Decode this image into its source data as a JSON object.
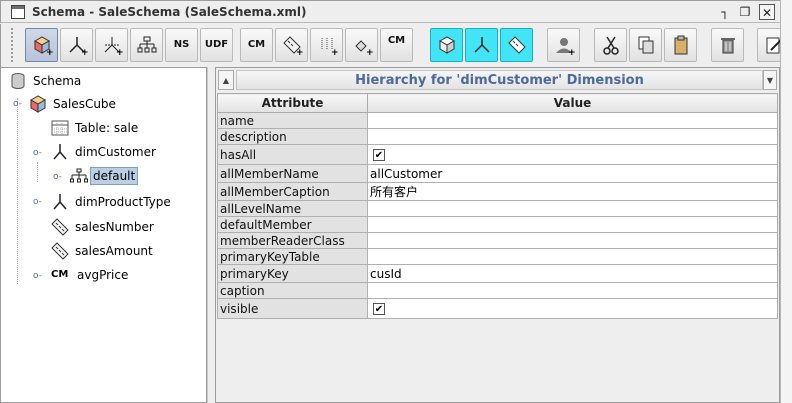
{
  "window": {
    "title": "Schema - SaleSchema (SaleSchema.xml)",
    "controls": {
      "iconify": "┐",
      "maximize": "❐",
      "close": "✕"
    }
  },
  "toolbar": {
    "buttons": [
      {
        "name": "add-cube",
        "label": "",
        "icon": "cube-add-icon",
        "state": "pressed"
      },
      {
        "name": "add-dimension",
        "label": "",
        "icon": "dimension-add-icon"
      },
      {
        "name": "add-dimension-usage",
        "label": "",
        "icon": "dimension-usage-add-icon"
      },
      {
        "name": "add-hierarchy",
        "label": "",
        "icon": "hierarchy-add-icon"
      },
      {
        "name": "add-named-set",
        "label": "NS",
        "icon": "named-set-add-icon"
      },
      {
        "name": "add-udf",
        "label": "UDF",
        "icon": "udf-add-icon"
      },
      {
        "name": "add-calculated-member",
        "label": "CM",
        "icon": "calculated-member-add-icon"
      },
      {
        "name": "add-measure",
        "label": "",
        "icon": "measure-add-icon"
      },
      {
        "name": "add-virtual-cube",
        "label": "",
        "icon": "virtual-cube-add-icon"
      },
      {
        "name": "add-parameter",
        "label": "",
        "icon": "parameter-add-icon"
      },
      {
        "name": "add-cube-calc",
        "label": "CM",
        "icon": "cube-calc-add-icon"
      },
      {
        "name": "add-virtual-cube-dim",
        "label": "",
        "icon": "virtual-cube-dim-icon",
        "state": "cyan"
      },
      {
        "name": "add-virtual-dimension",
        "label": "",
        "icon": "virtual-dimension-icon",
        "state": "cyan"
      },
      {
        "name": "add-virtual-measure",
        "label": "",
        "icon": "virtual-measure-icon",
        "state": "cyan"
      },
      {
        "name": "add-role",
        "label": "",
        "icon": "role-add-icon"
      },
      {
        "name": "cut",
        "label": "",
        "icon": "scissors-icon"
      },
      {
        "name": "copy",
        "label": "",
        "icon": "copy-icon"
      },
      {
        "name": "paste",
        "label": "",
        "icon": "paste-icon"
      },
      {
        "name": "delete",
        "label": "",
        "icon": "trash-icon"
      },
      {
        "name": "edit-mode",
        "label": "",
        "icon": "edit-icon"
      }
    ]
  },
  "tree": {
    "nodes": [
      {
        "label": "Schema",
        "icon": "schema-icon"
      },
      {
        "label": "SalesCube",
        "icon": "cube-icon"
      },
      {
        "label": "Table: sale",
        "icon": "table-icon"
      },
      {
        "label": "dimCustomer",
        "icon": "dimension-icon"
      },
      {
        "label": "default",
        "icon": "hierarchy-icon",
        "selected": true
      },
      {
        "label": "dimProductType",
        "icon": "dimension-icon"
      },
      {
        "label": "salesNumber",
        "icon": "measure-icon"
      },
      {
        "label": "salesAmount",
        "icon": "measure-icon"
      },
      {
        "label": "avgPrice",
        "icon": "calculated-member-icon",
        "prefix": "CM"
      }
    ]
  },
  "panel": {
    "title": "Hierarchy for 'dimCustomer' Dimension",
    "columns": [
      "Attribute",
      "Value"
    ],
    "rows": [
      {
        "attribute": "name",
        "value": ""
      },
      {
        "attribute": "description",
        "value": ""
      },
      {
        "attribute": "hasAll",
        "value": "",
        "checkbox": true,
        "checked": true
      },
      {
        "attribute": "allMemberName",
        "value": "allCustomer"
      },
      {
        "attribute": "allMemberCaption",
        "value": "所有客户"
      },
      {
        "attribute": "allLevelName",
        "value": ""
      },
      {
        "attribute": "defaultMember",
        "value": ""
      },
      {
        "attribute": "memberReaderClass",
        "value": ""
      },
      {
        "attribute": "primaryKeyTable",
        "value": ""
      },
      {
        "attribute": "primaryKey",
        "value": "cusId"
      },
      {
        "attribute": "caption",
        "value": ""
      },
      {
        "attribute": "visible",
        "value": "",
        "checkbox": true,
        "checked": true
      }
    ]
  },
  "colors": {
    "title_accent": "#4b6a9a",
    "selection": "#b8cfe5",
    "cyan_button": "#41e5f6"
  }
}
